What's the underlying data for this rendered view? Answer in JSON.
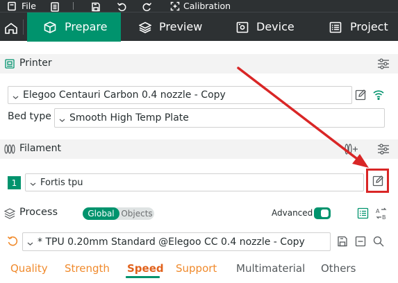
{
  "menubar": {
    "file_label": "File",
    "calibration_label": "Calibration"
  },
  "tabs": [
    {
      "label": "Prepare",
      "active": true
    },
    {
      "label": "Preview",
      "active": false
    },
    {
      "label": "Device",
      "active": false
    },
    {
      "label": "Project",
      "active": false
    }
  ],
  "printer": {
    "title": "Printer",
    "selected_printer": "Elegoo Centauri Carbon 0.4 nozzle - Copy",
    "bed_type_label": "Bed type",
    "bed_type_value": "Smooth High Temp Plate"
  },
  "filament": {
    "title": "Filament",
    "slot_number": "1",
    "selected_filament": "Fortis tpu"
  },
  "process": {
    "title": "Process",
    "scope_global": "Global",
    "scope_objects": "Objects",
    "advanced_label": "Advanced",
    "advanced_enabled": true,
    "selected_profile": "* TPU 0.20mm Standard @Elegoo CC 0.4 nozzle - Copy",
    "tabs": [
      "Quality",
      "Strength",
      "Speed",
      "Support",
      "Multimaterial",
      "Others"
    ],
    "active_tab": "Speed"
  },
  "colors": {
    "accent": "#00936d",
    "topbar": "#2d3133",
    "annotation": "#d92626",
    "tab_orange": "#f08a2c",
    "tab_active": "#e1621c"
  },
  "icons": [
    "file-icon",
    "notes-icon",
    "save-icon",
    "undo-icon",
    "redo-icon",
    "calibration-icon",
    "home-icon",
    "cube-icon",
    "layers-icon",
    "device-icon",
    "project-icon",
    "printer-icon",
    "tune-icon",
    "edit-icon",
    "wifi-icon",
    "filament-icon",
    "add-filament-icon",
    "process-icon",
    "list-icon",
    "compare-icon",
    "reset-icon",
    "delete-icon",
    "search-icon"
  ]
}
